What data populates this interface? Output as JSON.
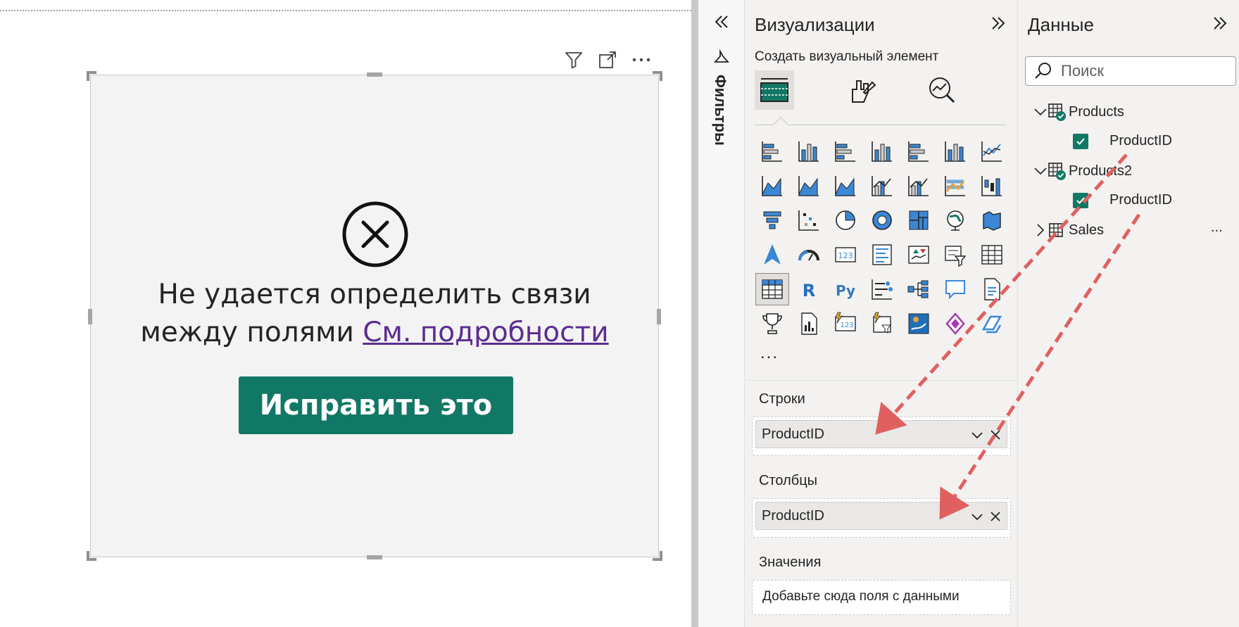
{
  "visual": {
    "error_line1": "Не удается определить связи",
    "error_line2": "между полями",
    "details_link": "См. подробности",
    "fix_button": "Исправить это"
  },
  "filters": {
    "label": "Фильтры"
  },
  "visualizations": {
    "title": "Визуализации",
    "subtitle": "Создать визуальный элемент",
    "more": "...",
    "wells": {
      "rows": {
        "label": "Строки",
        "field": "ProductID"
      },
      "columns": {
        "label": "Столбцы",
        "field": "ProductID"
      },
      "values": {
        "label": "Значения",
        "placeholder": "Добавьте сюда поля с данными"
      }
    },
    "icons": [
      "stacked-bar-chart-icon",
      "stacked-column-chart-icon",
      "clustered-bar-chart-icon",
      "clustered-column-chart-icon",
      "100-stacked-bar-chart-icon",
      "100-stacked-column-chart-icon",
      "line-chart-icon",
      "area-chart-icon",
      "stacked-area-chart-icon",
      "100-stacked-area-chart-icon",
      "line-and-stacked-column-chart-icon",
      "line-and-clustered-column-chart-icon",
      "ribbon-chart-icon",
      "waterfall-chart-icon",
      "funnel-chart-icon",
      "scatter-chart-icon",
      "pie-chart-icon",
      "donut-chart-icon",
      "treemap-icon",
      "map-icon",
      "filled-map-icon",
      "azure-map-icon",
      "gauge-icon",
      "card-icon",
      "multi-row-card-icon",
      "kpi-icon",
      "slicer-icon",
      "table-icon",
      "matrix-icon",
      "r-visual-icon",
      "python-visual-icon",
      "key-influencers-icon",
      "decomposition-tree-icon",
      "qa-icon",
      "smart-narrative-icon",
      "trophy-icon",
      "paginated-report-icon",
      "metrics-card-icon",
      "power-automate-icon",
      "arcgis-icon",
      "power-apps-icon",
      "goals-icon"
    ]
  },
  "data": {
    "title": "Данные",
    "search_placeholder": "Поиск",
    "tables": [
      {
        "name": "Products",
        "field": "ProductID"
      },
      {
        "name": "Products2",
        "field": "ProductID"
      },
      {
        "name": "Sales"
      }
    ],
    "row_more": "..."
  },
  "colors": {
    "accent": "#117865",
    "link": "#5c2d91",
    "arrow": "#e06060"
  }
}
